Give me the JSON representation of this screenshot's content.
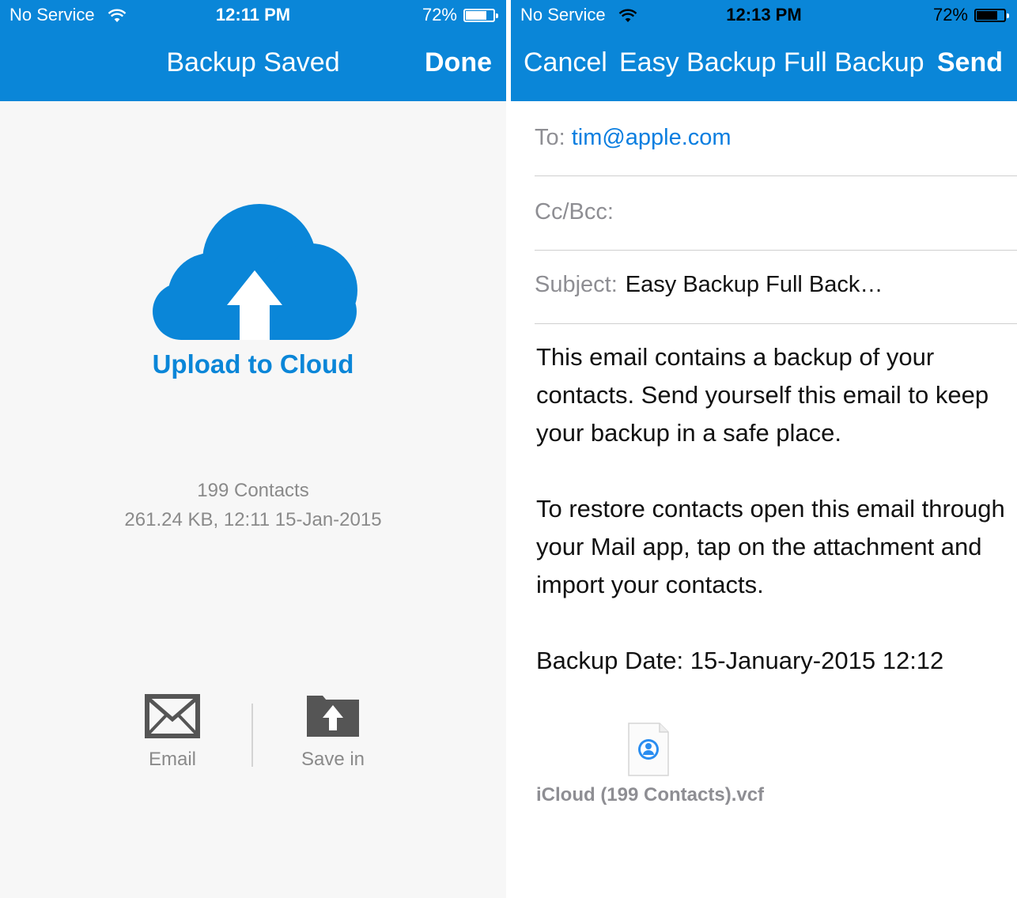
{
  "left": {
    "status": {
      "carrier": "No Service",
      "time": "12:11 PM",
      "battery": "72%",
      "battery_level": 0.72
    },
    "nav": {
      "title": "Backup Saved",
      "done": "Done"
    },
    "upload_label": "Upload to Cloud",
    "info": {
      "contacts": "199 Contacts",
      "details": "261.24 KB, 12:11 15-Jan-2015"
    },
    "actions": {
      "email": "Email",
      "save_in": "Save in"
    },
    "icons": {
      "cloud": "cloud-upload-icon",
      "email": "envelope-icon",
      "save": "folder-upload-icon"
    }
  },
  "right": {
    "status": {
      "carrier": "No Service",
      "time": "12:13 PM",
      "battery": "72%",
      "battery_level": 0.72
    },
    "nav": {
      "cancel": "Cancel",
      "title": "Easy Backup Full Backup",
      "send": "Send"
    },
    "to_label": "To:",
    "to_value": "tim@apple.com",
    "cc_label": "Cc/Bcc:",
    "subject_label": "Subject:",
    "subject_value": "Easy Backup Full Back…",
    "body": {
      "p1": "This email contains a backup of your contacts. Send yourself this email to keep your backup in a safe place.",
      "p2": "To restore contacts open this email through your Mail app, tap on the attachment and import your contacts.",
      "p3": "Backup Date: 15-January-2015 12:12"
    },
    "attachment": "iCloud (199 Contacts).vcf"
  },
  "colors": {
    "accent": "#0a86d8",
    "link": "#0a7ee0",
    "muted": "#8e8e93"
  }
}
